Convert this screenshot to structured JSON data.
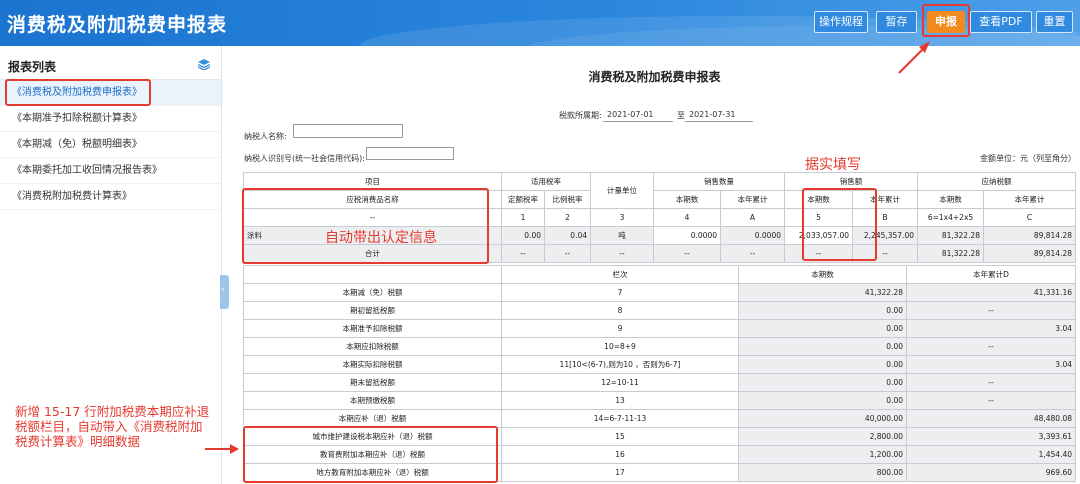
{
  "header": {
    "title": "消费税及附加税费申报表",
    "buttons": {
      "guide": "操作规程",
      "save": "暂存",
      "submit": "申报",
      "pdf": "查看PDF",
      "reset": "重置"
    }
  },
  "sidebar": {
    "title": "报表列表",
    "items": [
      "《消费税及附加税费申报表》",
      "《本期准予扣除税额计算表》",
      "《本期减（免）税额明细表》",
      "《本期委托加工收回情况报告表》",
      "《消费税附加税费计算表》"
    ]
  },
  "form": {
    "title": "消费税及附加税费申报表",
    "period_label": "税款所属期:",
    "period_from": "2021-07-01",
    "period_to_label": "至",
    "period_to": "2021-07-31",
    "taxpayer_name_label": "纳税人名称:",
    "taxpayer_id_label": "纳税人识别号(统一社会信用代码):",
    "unit_label": "金额单位：元（列至角分）"
  },
  "table1": {
    "group_headers": {
      "item": "项目",
      "rate": "适用税率",
      "unit": "计量单位",
      "sales_qty": "销售数量",
      "sales_amt": "销售额",
      "tax_payable": "应纳税额"
    },
    "sub_headers": {
      "name": "应税消费品名称",
      "fixed_rate": "定额税率",
      "ratio_rate": "比例税率",
      "qty_current": "本期数",
      "qty_ytd": "本年累计",
      "amt_current": "本期数",
      "amt_ytd": "本年累计",
      "tax_current": "本期数",
      "tax_ytd": "本年累计"
    },
    "index_row": [
      "--",
      "1",
      "2",
      "3",
      "4",
      "A",
      "5",
      "B",
      "6=1x4+2x5",
      "C"
    ],
    "data_row": [
      "涂料",
      "0.00",
      "0.04",
      "吨",
      "0.0000",
      "0.0000",
      "2,033,057.00",
      "2,245,357.00",
      "81,322.28",
      "89,814.28"
    ],
    "total_row": [
      "合计",
      "--",
      "--",
      "--",
      "--",
      "--",
      "--",
      "--",
      "81,322.28",
      "89,814.28"
    ]
  },
  "table2": {
    "headers": {
      "col": "栏次",
      "current": "本期数",
      "ytd": "本年累计D"
    },
    "rows": [
      {
        "name": "本期减（免）税额",
        "col": "7",
        "current": "41,322.28",
        "ytd": "41,331.16"
      },
      {
        "name": "期初留抵税额",
        "col": "8",
        "current": "0.00",
        "ytd": "--"
      },
      {
        "name": "本期准予扣除税额",
        "col": "9",
        "current": "0.00",
        "ytd": "3.04"
      },
      {
        "name": "本期应扣除税额",
        "col": "10=8+9",
        "current": "0.00",
        "ytd": "--"
      },
      {
        "name": "本期实际扣除税额",
        "col": "11[10<(6-7),则为10 ，否则为6-7]",
        "current": "0.00",
        "ytd": "3.04"
      },
      {
        "name": "期末留抵税额",
        "col": "12=10-11",
        "current": "0.00",
        "ytd": "--"
      },
      {
        "name": "本期预缴税额",
        "col": "13",
        "current": "0.00",
        "ytd": "--"
      },
      {
        "name": "本期应补（退）税额",
        "col": "14=6-7-11-13",
        "current": "40,000.00",
        "ytd": "48,480.08"
      },
      {
        "name": "城市维护建设税本期应补（退）税额",
        "col": "15",
        "current": "2,800.00",
        "ytd": "3,393.61"
      },
      {
        "name": "教育费附加本期应补（退）税额",
        "col": "16",
        "current": "1,200.00",
        "ytd": "1,454.40"
      },
      {
        "name": "地方教育附加本期应补（退）税额",
        "col": "17",
        "current": "800.00",
        "ytd": "969.60"
      }
    ]
  },
  "annotations": {
    "fill_truthfully": "据实填写",
    "auto_info": "自动带出认定信息",
    "new_rows": [
      "新增 15-17 行附加税费本期应补退",
      "税额栏目，自动带入《消费税附加",
      "税费计算表》明细数据"
    ]
  },
  "colors": {
    "header_blue": "#1a74d0",
    "submit_orange": "#f28a1d",
    "annotation_red": "#e53a2f"
  }
}
